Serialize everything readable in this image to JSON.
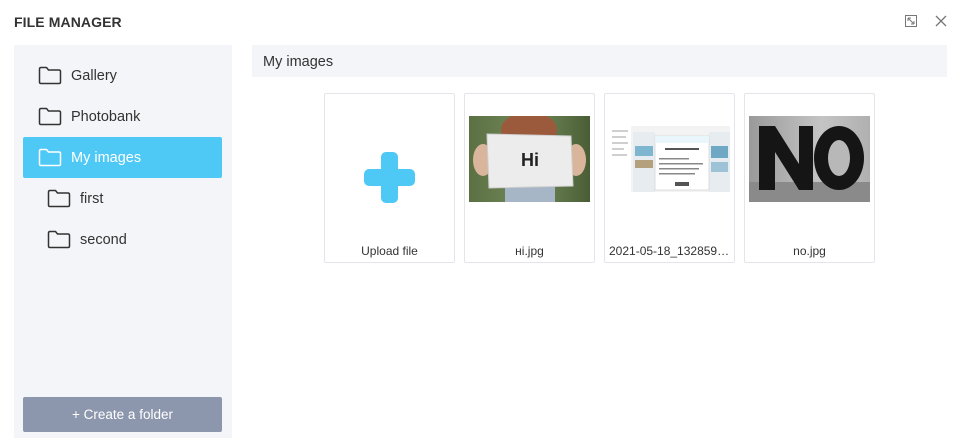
{
  "header": {
    "title": "FILE MANAGER",
    "expand_icon": "expand-icon",
    "close_icon": "close-icon"
  },
  "sidebar": {
    "folders": [
      {
        "label": "Gallery",
        "icon": "folder-icon",
        "active": false,
        "level": 0
      },
      {
        "label": "Photobank",
        "icon": "folder-icon",
        "active": false,
        "level": 0
      },
      {
        "label": "My images",
        "icon": "folder-icon",
        "active": true,
        "level": 0
      },
      {
        "label": "first",
        "icon": "folder-icon",
        "active": false,
        "level": 1
      },
      {
        "label": "second",
        "icon": "folder-icon",
        "active": false,
        "level": 1
      }
    ],
    "create_button": "+ Create a folder"
  },
  "main": {
    "title": "My images",
    "items": [
      {
        "label": "Upload file",
        "icon": "plus-icon"
      },
      {
        "label": "ні.jpg"
      },
      {
        "label": "2021-05-18_132859...."
      },
      {
        "label": "no.jpg"
      }
    ]
  },
  "colors": {
    "accent": "#4ec9f5",
    "panel_bg": "#f4f5f9",
    "button_bg": "#8c97ad",
    "text": "#333333"
  }
}
